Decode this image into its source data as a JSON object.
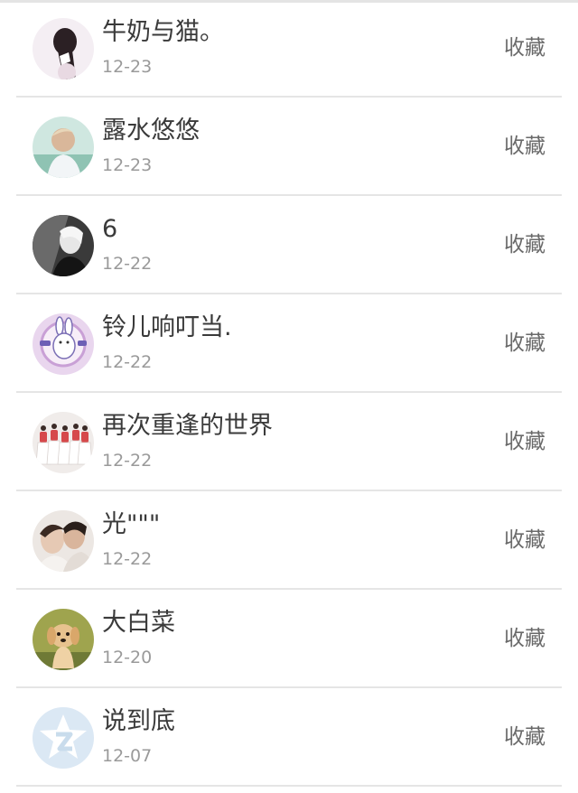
{
  "items": [
    {
      "name": "牛奶与猫。",
      "date": "12-23",
      "action": "收藏",
      "avatar_icon": "girl-bow-avatar"
    },
    {
      "name": "露水悠悠",
      "date": "12-23",
      "action": "收藏",
      "avatar_icon": "boy-seaside-avatar"
    },
    {
      "name": "6",
      "date": "12-22",
      "action": "收藏",
      "avatar_icon": "bw-portrait-avatar"
    },
    {
      "name": "铃儿响叮当.",
      "date": "12-22",
      "action": "收藏",
      "avatar_icon": "bunny-cartoon-avatar"
    },
    {
      "name": "再次重逢的世界",
      "date": "12-22",
      "action": "收藏",
      "avatar_icon": "dancers-avatar"
    },
    {
      "name": "光\"\"\"",
      "date": "12-22",
      "action": "收藏",
      "avatar_icon": "couple-avatar"
    },
    {
      "name": "大白菜",
      "date": "12-20",
      "action": "收藏",
      "avatar_icon": "puppy-avatar"
    },
    {
      "name": "说到底",
      "date": "12-07",
      "action": "收藏",
      "avatar_icon": "default-qq-avatar"
    }
  ]
}
